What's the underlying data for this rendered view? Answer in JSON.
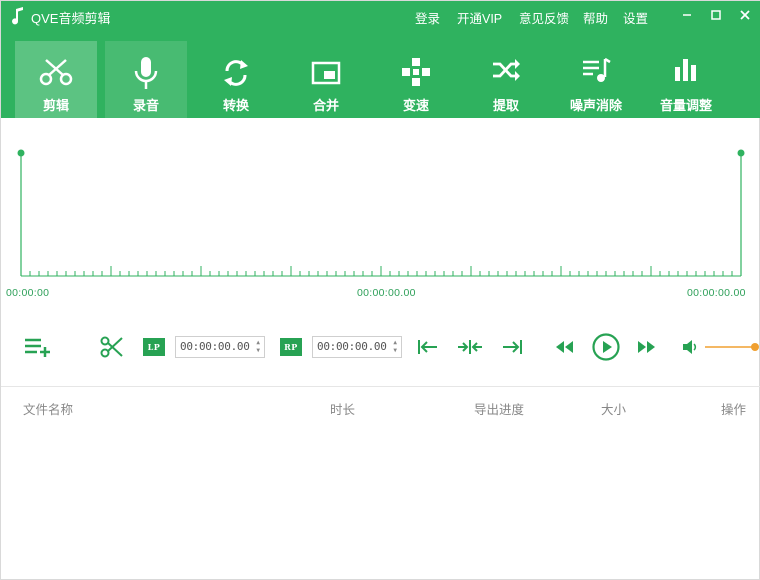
{
  "title": "QVE音频剪辑",
  "menu": {
    "login": "登录",
    "vip": "开通VIP",
    "feedback": "意见反馈",
    "help": "帮助",
    "settings": "设置"
  },
  "window_controls": {
    "minimize": "−",
    "maximize": "☐",
    "close": "✕"
  },
  "tools": [
    {
      "label": "剪辑",
      "icon": "scissors-icon",
      "state": "active"
    },
    {
      "label": "录音",
      "icon": "microphone-icon",
      "state": "hover"
    },
    {
      "label": "转换",
      "icon": "convert-icon",
      "state": "normal"
    },
    {
      "label": "合并",
      "icon": "merge-icon",
      "state": "normal"
    },
    {
      "label": "变速",
      "icon": "speed-icon",
      "state": "normal"
    },
    {
      "label": "提取",
      "icon": "extract-icon",
      "state": "normal"
    },
    {
      "label": "噪声消除",
      "icon": "noise-removal-icon",
      "state": "normal"
    },
    {
      "label": "音量调整",
      "icon": "volume-adjust-icon",
      "state": "normal"
    }
  ],
  "timeline": {
    "start": "00:00:00",
    "middle": "00:00:00.00",
    "end": "00:00:00.00"
  },
  "controls": {
    "lp_tag": "LP",
    "rp_tag": "RP",
    "lp_time": "00:00:00.00",
    "rp_time": "00:00:00.00",
    "volume": 1.0
  },
  "table": {
    "columns": [
      "文件名称",
      "时长",
      "导出进度",
      "大小",
      "操作"
    ]
  },
  "colors": {
    "brand": "#2fb25f",
    "accent": "#27a253",
    "volume": "#f0a030"
  }
}
